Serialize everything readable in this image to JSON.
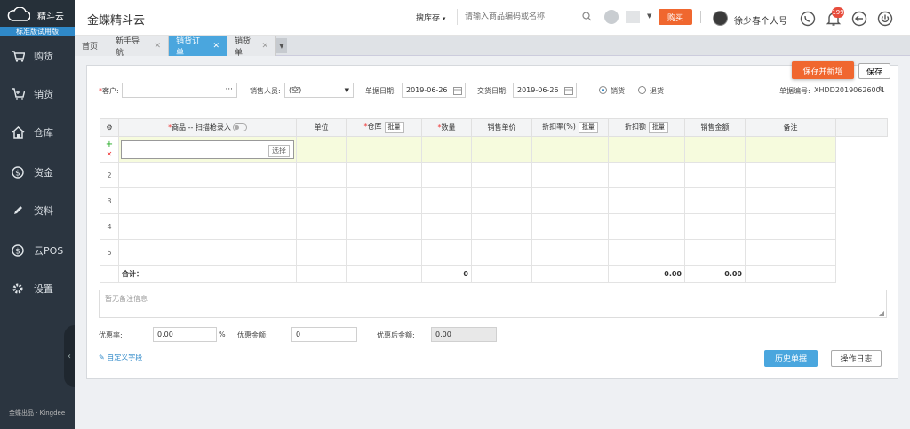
{
  "sidebar": {
    "brand": "精斗云",
    "version": "标准版试用版",
    "items": [
      {
        "label": "购货",
        "icon": "cart-icon"
      },
      {
        "label": "销货",
        "icon": "sale-cart-icon"
      },
      {
        "label": "仓库",
        "icon": "warehouse-icon"
      },
      {
        "label": "资金",
        "icon": "money-icon"
      },
      {
        "label": "资料",
        "icon": "pencil-icon"
      },
      {
        "label": "云POS",
        "icon": "pos-icon"
      },
      {
        "label": "设置",
        "icon": "gear-icon"
      }
    ],
    "footer": "金蝶出品 · Kingdee"
  },
  "header": {
    "title": "金蝶精斗云",
    "search_scope": "搜库存",
    "search_placeholder": "请输入商品编码或名称",
    "buy_label": "购买",
    "user_name": "徐少春个人号",
    "notif_count": "199"
  },
  "tabs": [
    {
      "label": "首页"
    },
    {
      "label": "新手导航"
    },
    {
      "label": "销货订单"
    },
    {
      "label": "销货单"
    }
  ],
  "form": {
    "save_new_label": "保存并新增",
    "save_label": "保存",
    "customer_label": "客户",
    "customer_value": "",
    "salesperson_label": "销售人员",
    "salesperson_value": "(空)",
    "doc_date_label": "单据日期",
    "doc_date_value": "2019-06-26",
    "delivery_date_label": "交货日期",
    "delivery_date_value": "2019-06-26",
    "radio_sale": "销货",
    "radio_return": "退货",
    "doc_no_label": "单据编号",
    "doc_no_value": "XHDD20190626001"
  },
  "grid": {
    "headers": {
      "product": "商品 -- 扫描枪录入",
      "unit": "单位",
      "warehouse": "仓库",
      "batch": "批量",
      "qty": "数量",
      "price": "销售单价",
      "discount_rate": "折扣率(%)",
      "discount_amt": "折扣额",
      "amount": "销售金额",
      "remark": "备注"
    },
    "select_label": "选择",
    "row_numbers": [
      "2",
      "3",
      "4",
      "5"
    ],
    "total_label": "合计：",
    "total_qty": "0",
    "total_discount": "0.00",
    "total_amount": "0.00"
  },
  "footer_form": {
    "remark_placeholder": "暂无备注信息",
    "discount_rate_label": "优惠率",
    "discount_rate_value": "0.00",
    "percent": "%",
    "discount_amt_label": "优惠金额",
    "discount_amt_value": "0",
    "after_discount_label": "优惠后金额",
    "after_discount_value": "0.00",
    "custom_field_label": "自定义字段",
    "history_label": "历史单据",
    "log_label": "操作日志"
  }
}
